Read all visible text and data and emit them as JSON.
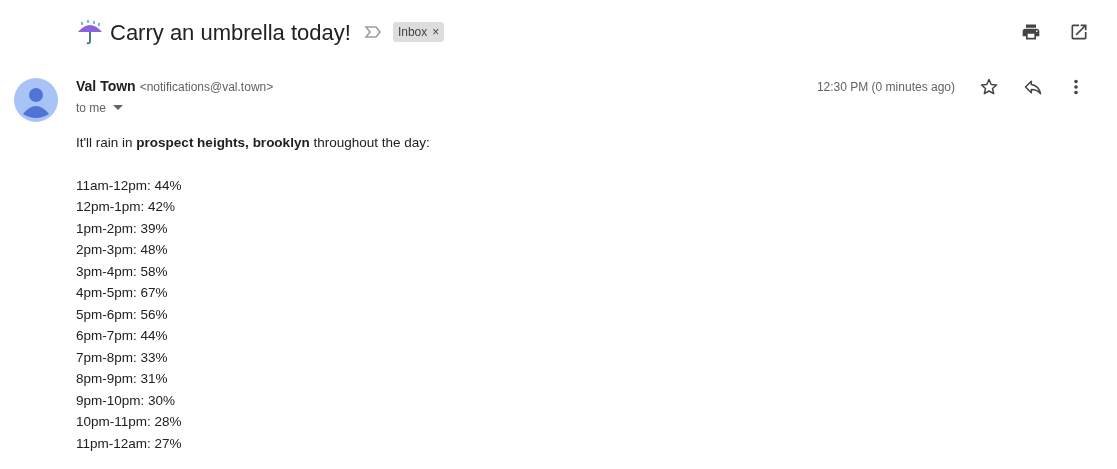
{
  "subject": "Carry an umbrella today!",
  "label": {
    "text": "Inbox",
    "remove": "×"
  },
  "sender": {
    "name": "Val Town",
    "email": "<notifications@val.town>",
    "recipient": "to me"
  },
  "time": "12:30 PM (0 minutes ago)",
  "starred": false,
  "intro": "It'll rain in **prospect heights, brooklyn** throughout the day:",
  "forecast": [
    "11am-12pm: 44%",
    "12pm-1pm: 42%",
    "1pm-2pm: 39%",
    "2pm-3pm: 48%",
    "3pm-4pm: 58%",
    "4pm-5pm: 67%",
    "5pm-6pm: 56%",
    "6pm-7pm: 44%",
    "7pm-8pm: 33%",
    "8pm-9pm: 31%",
    "9pm-10pm: 30%",
    "10pm-11pm: 28%",
    "11pm-12am: 27%"
  ]
}
